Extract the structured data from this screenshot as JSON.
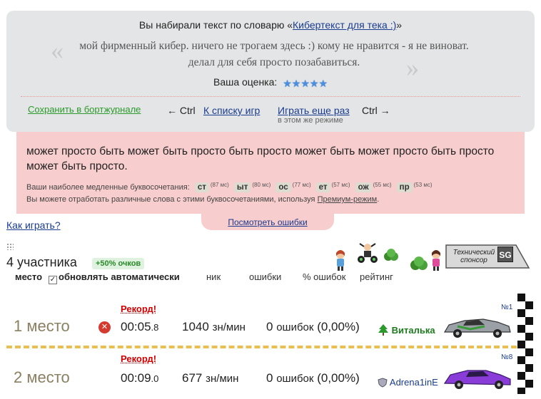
{
  "dictionary": {
    "header_prefix": "Вы набирали текст по словарю «",
    "header_link": "Кибертекст для тека :)",
    "header_suffix": "»",
    "quote": "мой фирменный кибер. ничего не трогаем здесь :) кому не нравится - я не виноват. делал для себя просто позабавиться.",
    "rating_label": "Ваша оценка:",
    "rating_stars": 5,
    "save_link": "Сохранить в бортжурнале",
    "ctrl_left": "← Ctrl",
    "list_link": "К списку игр",
    "again_link": "Играть еще раз",
    "ctrl_right": "Ctrl →",
    "same_mode": "в этом же режиме"
  },
  "typed": {
    "text": "может просто быть может быть просто быть просто может быть может просто быть просто может быть просто.",
    "slow_label": "Ваши наиболее медленные буквосочетания:",
    "combos": [
      {
        "text": "ст",
        "ms": "(87 мс)"
      },
      {
        "text": "ыт",
        "ms": "(80 мс)"
      },
      {
        "text": "ос",
        "ms": "(77 мс)"
      },
      {
        "text": "ет",
        "ms": "(57 мс)"
      },
      {
        "text": "ож",
        "ms": "(55 мс)"
      },
      {
        "text": "пр",
        "ms": "(53 мс)"
      }
    ],
    "practice_prefix": "Вы можете отработать различные слова с этими буквосочетаниями, используя",
    "practice_link": "Премиум-режим",
    "practice_suffix": ".",
    "errors_link": "Посмотреть ошибки"
  },
  "howto_link": "Как играть?",
  "participants": {
    "title": "4 участника",
    "bonus": "+50% очков",
    "col_place": "место",
    "auto_update": "обновлять автоматически",
    "auto_update_checked": true,
    "col_nick": "ник",
    "col_errors": "ошибки",
    "col_pct": "% ошибок",
    "col_rating": "рейтинг",
    "sponsor_text": "Технический спонсор",
    "sponsor_logo": "SG"
  },
  "rows": [
    {
      "record": "Рекорд!",
      "place": "1 место",
      "time_main": "00:05",
      "time_frac": ".8",
      "speed": "1040",
      "speed_unit": "зн/мин",
      "errors_count": "0",
      "errors_word": "ошибок",
      "errors_pct": "(0,00%)",
      "nick": "Виталька",
      "car_number": "№1",
      "car_color": "#9aa0a6"
    },
    {
      "record": "Рекорд!",
      "place": "2 место",
      "time_main": "00:09",
      "time_frac": ".0",
      "speed": "677",
      "speed_unit": "зн/мин",
      "errors_count": "0",
      "errors_word": "ошибок",
      "errors_pct": "(0,00%)",
      "nick": "Adrena1inE",
      "car_number": "№8",
      "car_color": "#8a3cd8"
    }
  ],
  "colors": {
    "grey_panel": "#e4e5e6",
    "pink_panel": "#f8cdcd",
    "record_red": "#d00000",
    "place_text": "#8a7f60",
    "dash_yellow": "#e8bf50"
  }
}
